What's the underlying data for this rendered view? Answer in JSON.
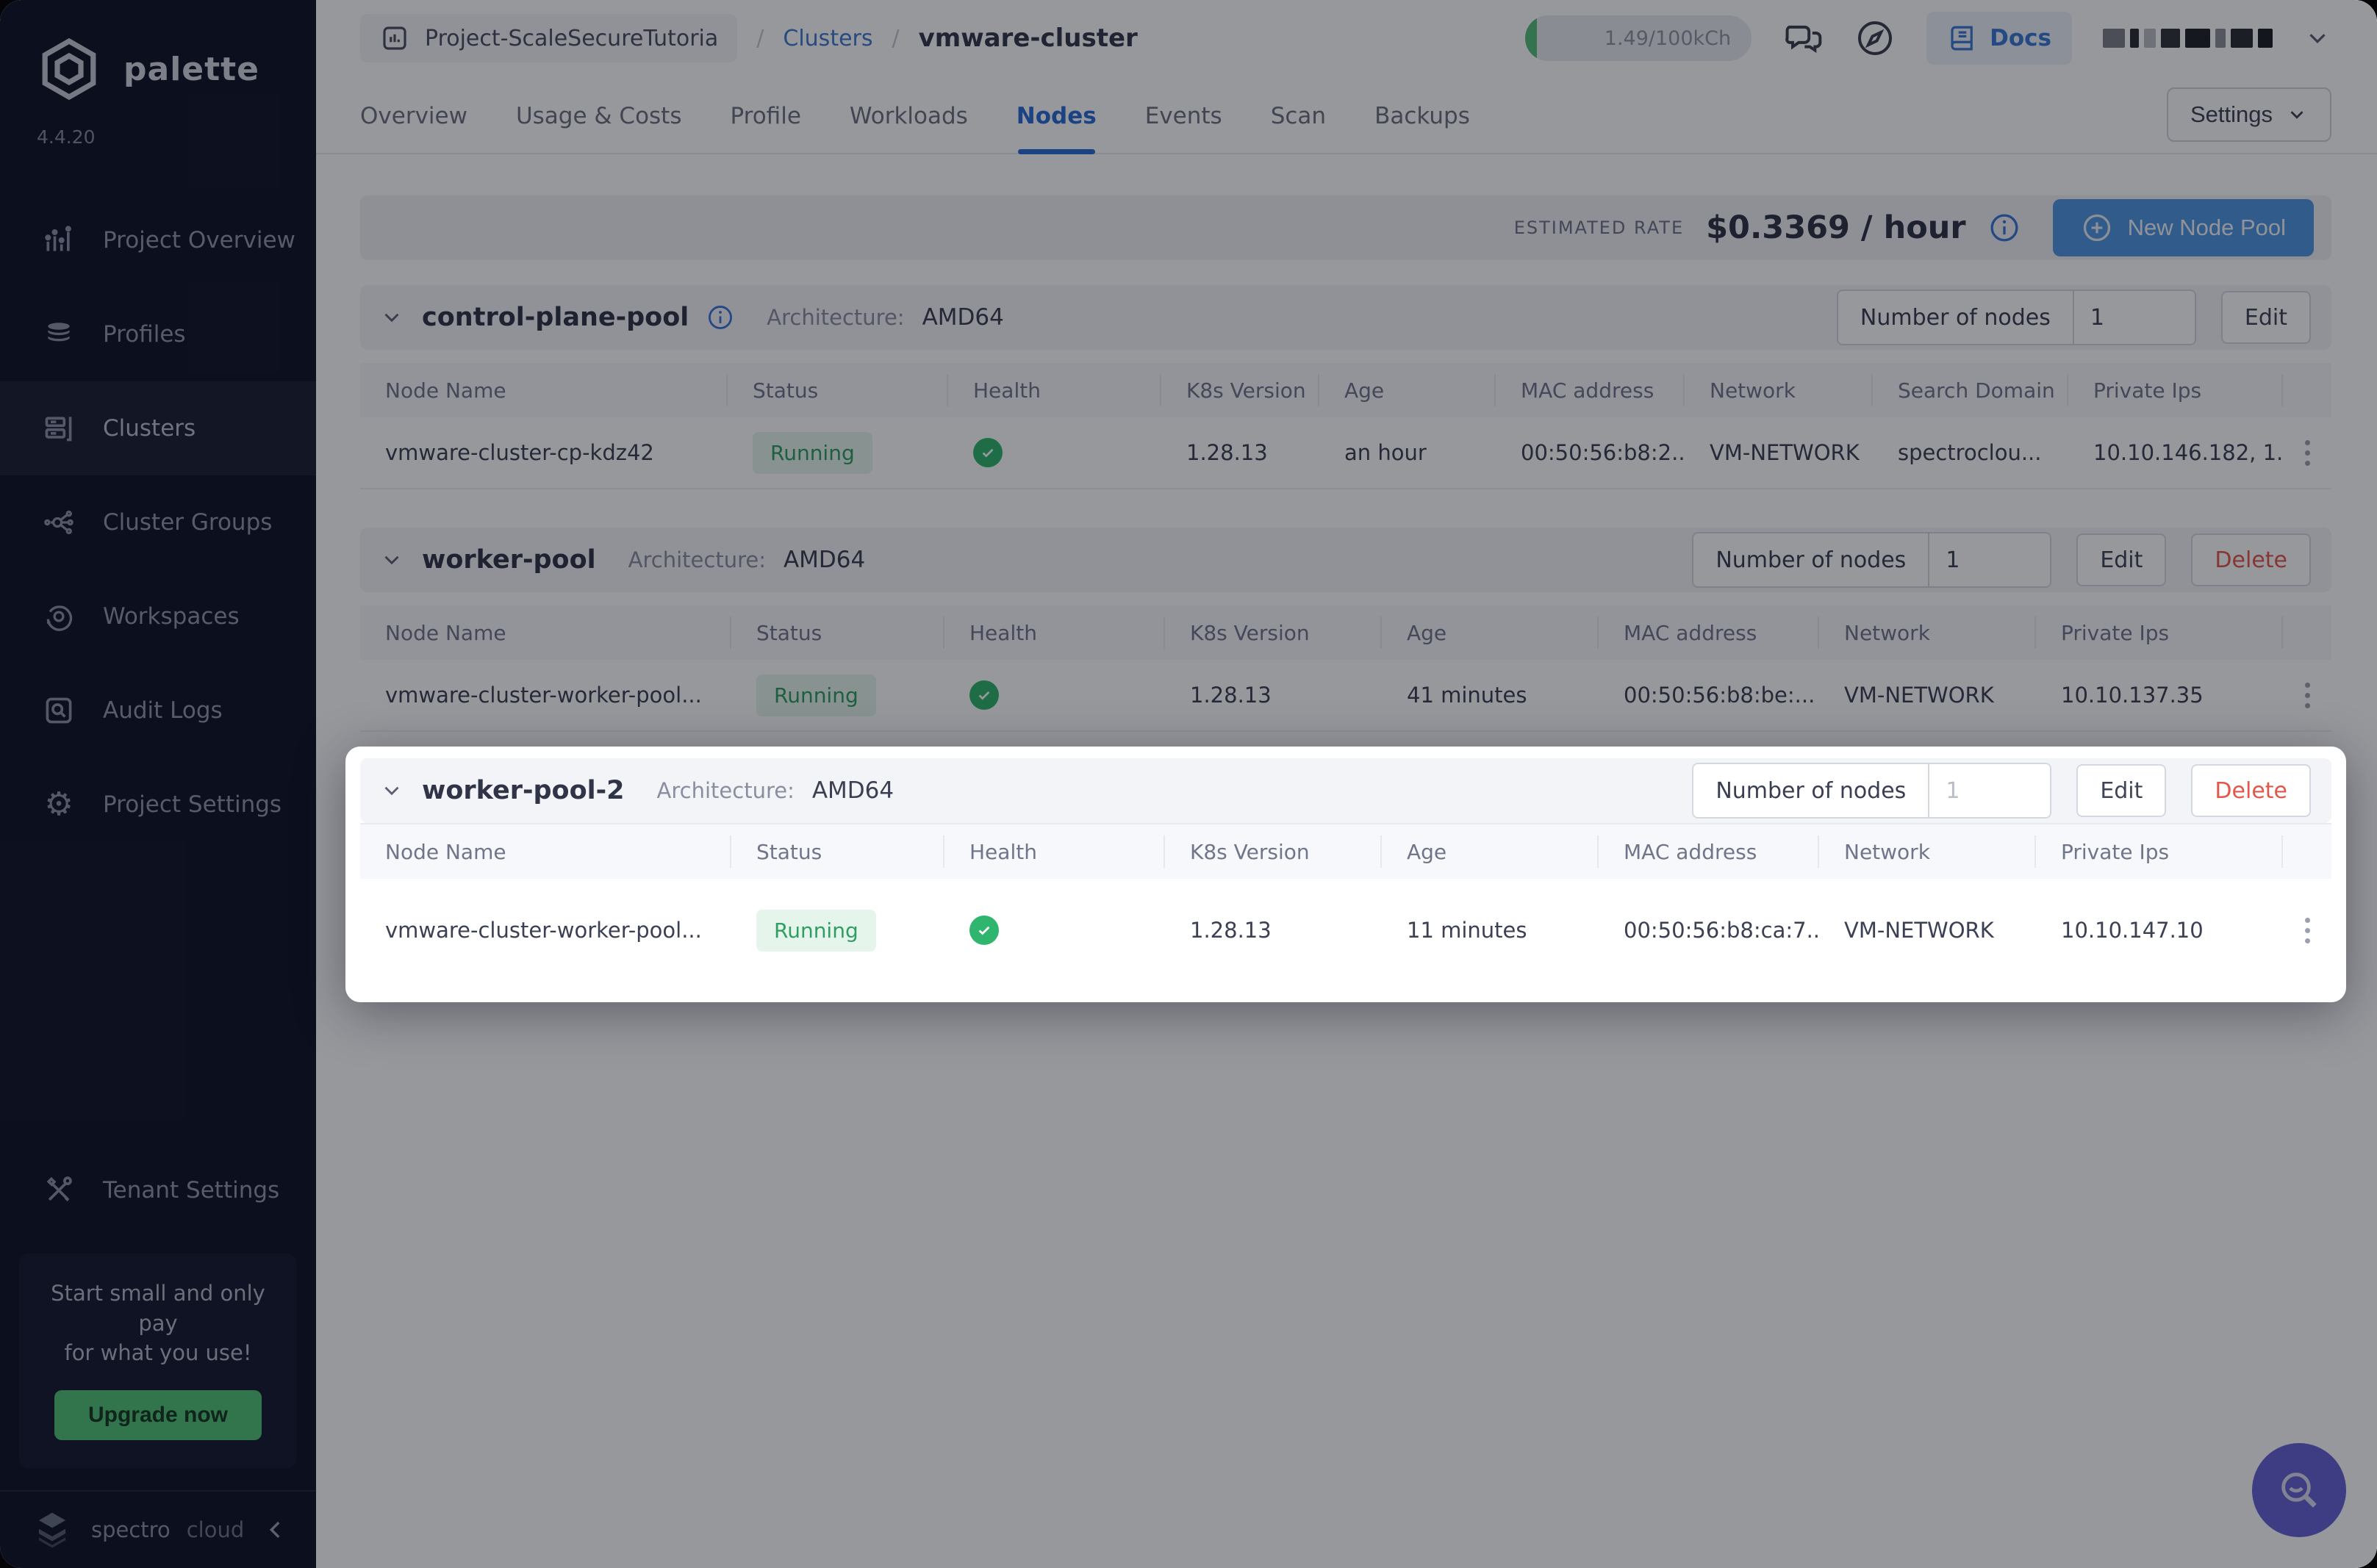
{
  "app": {
    "brand": "palette",
    "version": "4.4.20"
  },
  "sidebar": {
    "items": [
      {
        "label": "Project Overview"
      },
      {
        "label": "Profiles"
      },
      {
        "label": "Clusters"
      },
      {
        "label": "Cluster Groups"
      },
      {
        "label": "Workspaces"
      },
      {
        "label": "Audit Logs"
      },
      {
        "label": "Project Settings"
      }
    ],
    "active_item": "Clusters",
    "tenant_settings": "Tenant Settings",
    "promo_line1": "Start small and only pay",
    "promo_line2": "for what you use!",
    "upgrade_label": "Upgrade now",
    "footer_brand_1": "spectro",
    "footer_brand_2": "cloud"
  },
  "topbar": {
    "breadcrumb_project": "Project-ScaleSecureTutoria",
    "separator": "/",
    "breadcrumb_section": "Clusters",
    "breadcrumb_cluster": "vmware-cluster",
    "usage": "1.49/100kCh",
    "docs_label": "Docs"
  },
  "tabs": {
    "items": [
      "Overview",
      "Usage & Costs",
      "Profile",
      "Workloads",
      "Nodes",
      "Events",
      "Scan",
      "Backups"
    ],
    "active": "Nodes",
    "settings_label": "Settings"
  },
  "ratebar": {
    "label": "ESTIMATED RATE",
    "value": "$0.3369 / hour",
    "new_node_pool": "New Node Pool"
  },
  "labels": {
    "architecture": "Architecture:",
    "number_of_nodes": "Number of nodes",
    "edit": "Edit",
    "delete": "Delete"
  },
  "pools": [
    {
      "name": "control-plane-pool",
      "architecture": "AMD64",
      "nodes_value": "1",
      "columns": [
        "Node Name",
        "Status",
        "Health",
        "K8s Version",
        "Age",
        "MAC address",
        "Network",
        "Search Domain",
        "Private Ips"
      ],
      "row": {
        "name": "vmware-cluster-cp-kdz42",
        "status": "Running",
        "k8s_version": "1.28.13",
        "age": "an hour",
        "mac": "00:50:56:b8:2...",
        "network": "VM-NETWORK",
        "search_domain": "spectroclou...",
        "private_ips": "10.10.146.182, 1..."
      }
    },
    {
      "name": "worker-pool",
      "architecture": "AMD64",
      "nodes_value": "1",
      "columns": [
        "Node Name",
        "Status",
        "Health",
        "K8s Version",
        "Age",
        "MAC address",
        "Network",
        "Private Ips"
      ],
      "row": {
        "name": "vmware-cluster-worker-pool...",
        "status": "Running",
        "k8s_version": "1.28.13",
        "age": "41 minutes",
        "mac": "00:50:56:b8:be:...",
        "network": "VM-NETWORK",
        "private_ips": "10.10.137.35"
      }
    },
    {
      "name": "worker-pool-2",
      "architecture": "AMD64",
      "nodes_placeholder": "1",
      "columns": [
        "Node Name",
        "Status",
        "Health",
        "K8s Version",
        "Age",
        "MAC address",
        "Network",
        "Private Ips"
      ],
      "row": {
        "name": "vmware-cluster-worker-pool...",
        "status": "Running",
        "k8s_version": "1.28.13",
        "age": "11 minutes",
        "mac": "00:50:56:b8:ca:7...",
        "network": "VM-NETWORK",
        "private_ips": "10.10.147.10"
      }
    }
  ],
  "colors": {
    "accent_blue": "#2a6bd4",
    "success_green": "#2f9e63",
    "danger_red": "#e2574b",
    "upgrade_green": "#52c274",
    "fab_purple": "#6661d2"
  }
}
